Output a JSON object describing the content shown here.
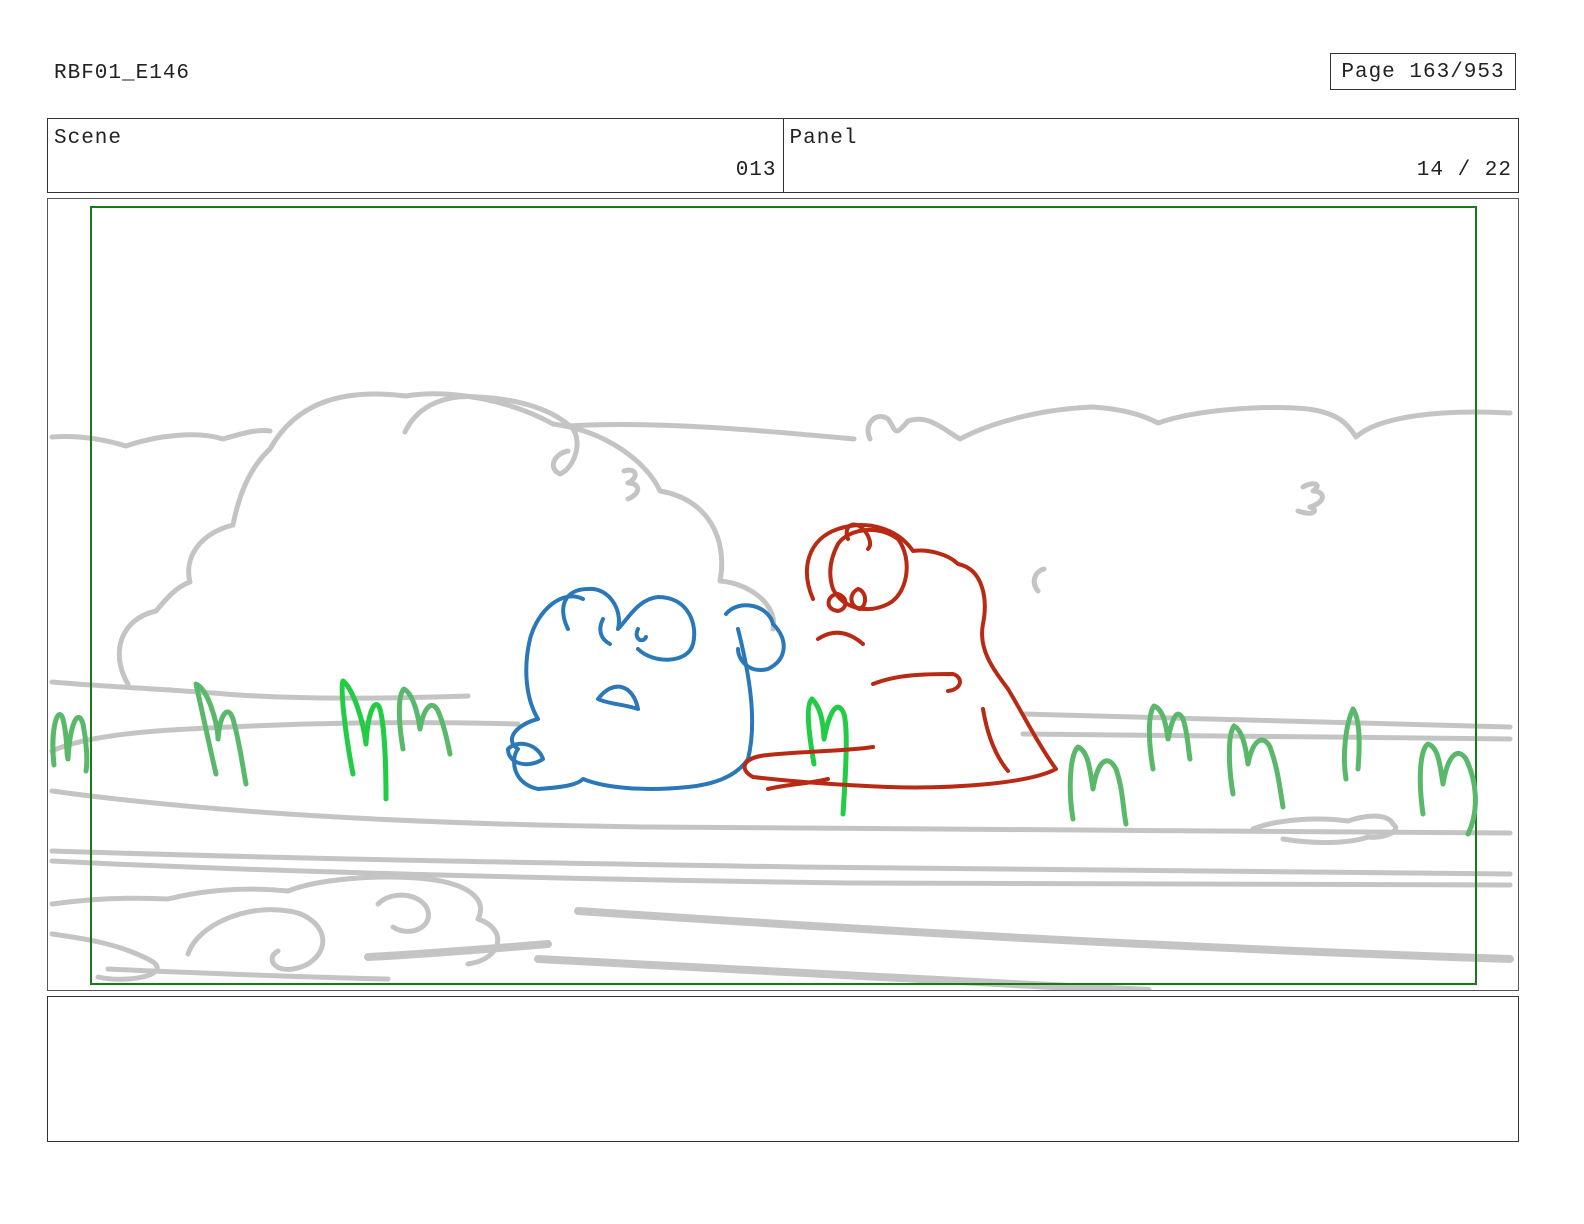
{
  "header": {
    "doc_id": "RBF01_E146",
    "page_label": "Page 163/953"
  },
  "info": {
    "scene_label": "Scene",
    "scene_value": "013",
    "panel_label": "Panel",
    "panel_value": "14 / 22"
  },
  "sketch": {
    "colors": {
      "background_lines": "#c4c4c4",
      "blue_character": "#2a78b8",
      "red_character": "#b82a14",
      "grass_bright": "#22cc44",
      "grass_soft": "#5ab86a",
      "safe_frame": "#1a7a1a"
    }
  },
  "notes": {
    "text": ""
  }
}
